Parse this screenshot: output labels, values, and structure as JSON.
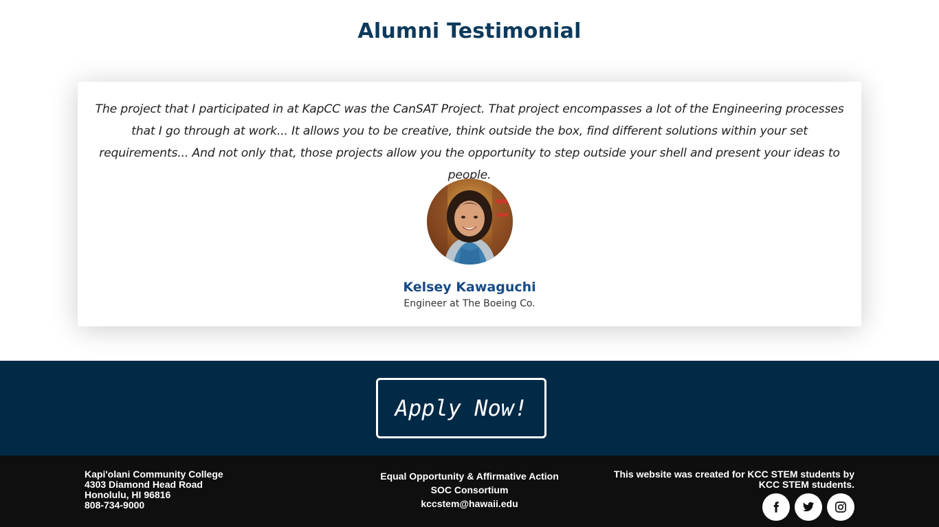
{
  "testimonial": {
    "heading": "Alumni Testimonial",
    "quote": "The project that I participated in at KapCC was the CanSAT Project. That project encompasses a lot of the Engineering processes that I go through at work... It allows you to be creative, think outside the box, find different solutions within your set requirements... And not only that, those projects allow you the opportunity to step outside your shell and present your ideas to people.",
    "name": "Kelsey Kawaguchi",
    "role": "Engineer at The Boeing Co."
  },
  "cta": {
    "label": "Apply Now!"
  },
  "footer": {
    "address": {
      "college": "Kapi'olani Community College",
      "street": "4303 Diamond Head Road",
      "city": "Honolulu, HI 96816",
      "phone": "808-734-9000"
    },
    "links": {
      "eeo": "Equal Opportunity & Affirmative Action",
      "soc": "SOC Consortium",
      "email": "kccstem@hawaii.edu"
    },
    "credit": "This website was created for KCC STEM students by KCC STEM students.",
    "social": [
      {
        "icon": "facebook-icon"
      },
      {
        "icon": "twitter-icon"
      },
      {
        "icon": "instagram-icon"
      }
    ]
  },
  "colors": {
    "heading": "#0d3a5c",
    "name": "#174a85",
    "cta_band": "#012a47",
    "footer_bg": "#0f0f0f"
  }
}
